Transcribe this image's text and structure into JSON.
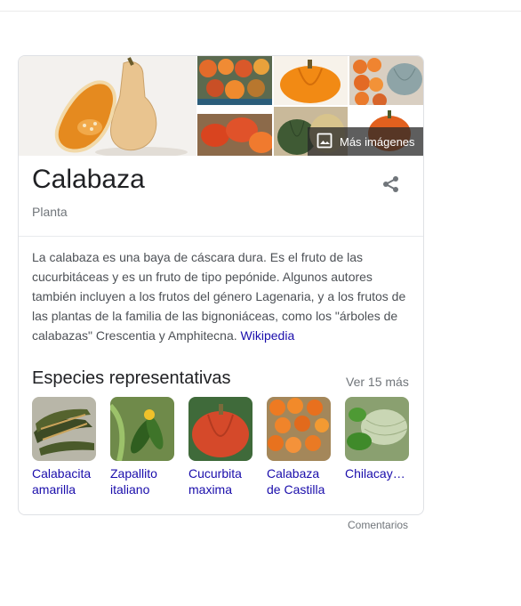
{
  "panel": {
    "title": "Calabaza",
    "subtitle": "Planta",
    "more_images_label": "Más imágenes",
    "description": "La calabaza es una baya de cáscara dura. Es el fruto de las cucurbitáceas y es un fruto de tipo pepónide. Algunos autores también incluyen a los frutos del género Lagenaria, y a los frutos de las plantas de la familia de las bignoniáceas, como los \"árboles de calabazas\" Crescentia y Amphitecna.",
    "source_link": "Wikipedia",
    "section_title": "Especies representativas",
    "see_more": "Ver 15 más",
    "species": [
      {
        "line1": "Calabacita",
        "line2": "amarilla"
      },
      {
        "line1": "Zapallito",
        "line2": "italiano"
      },
      {
        "line1": "Cucurbita",
        "line2": "maxima"
      },
      {
        "line1": "Calabaza",
        "line2": "de Castilla"
      },
      {
        "line1": "Chilacay…",
        "line2": ""
      }
    ]
  },
  "feedback_label": "Comentarios",
  "colors": {
    "link": "#1a0dab",
    "text": "#202124",
    "muted": "#70757a",
    "border": "#dfe1e5"
  },
  "icons": [
    "image-icon",
    "share-icon"
  ]
}
